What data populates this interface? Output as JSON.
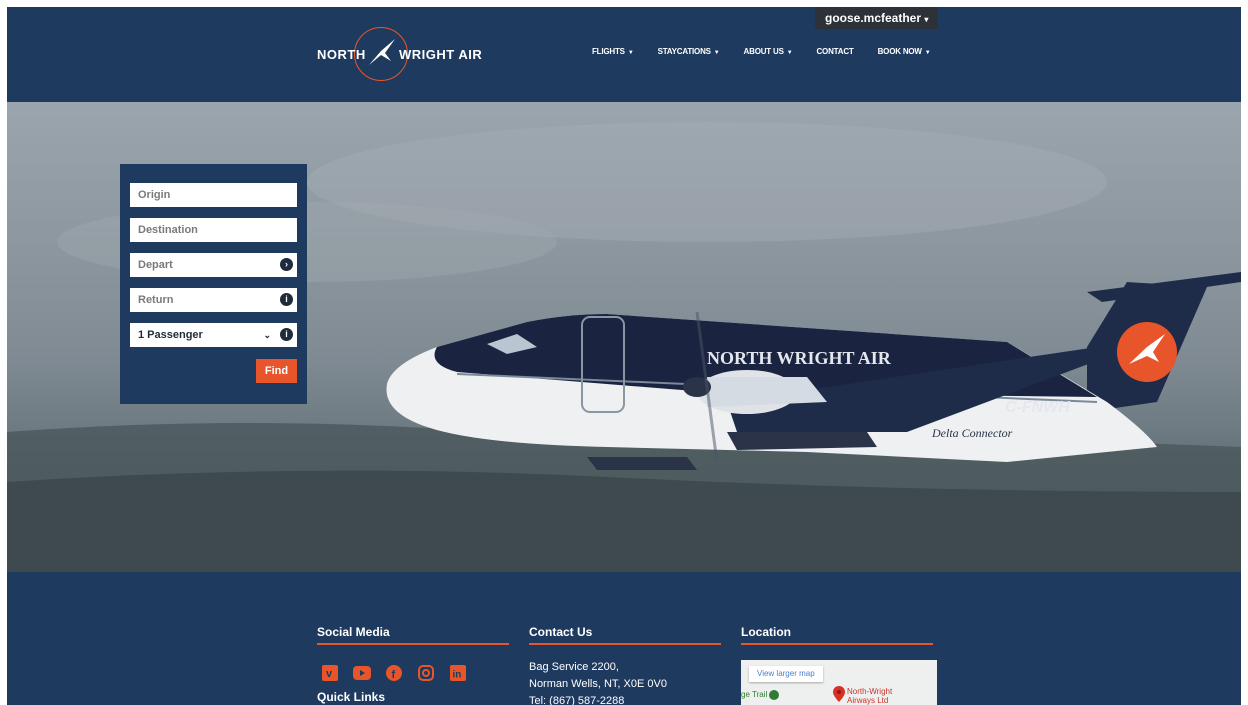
{
  "header": {
    "user": "goose.mcfeather",
    "logo_left": "NORTH",
    "logo_right": "WRIGHT AIR",
    "nav": [
      {
        "label": "FLIGHTS",
        "caret": true
      },
      {
        "label": "STAYCATIONS",
        "caret": true
      },
      {
        "label": "ABOUT US",
        "caret": true
      },
      {
        "label": "CONTACT",
        "caret": false
      },
      {
        "label": "BOOK NOW",
        "caret": true
      }
    ]
  },
  "hero": {
    "plane_livery": "NORTH WRIGHT AIR",
    "registration": "C-FNWH",
    "tagline": "Delta Connector"
  },
  "booking": {
    "origin_placeholder": "Origin",
    "destination_placeholder": "Destination",
    "depart_placeholder": "Depart",
    "return_placeholder": "Return",
    "passengers": "1 Passenger",
    "find_label": "Find"
  },
  "footer": {
    "social_title": "Social Media",
    "quick_links_title": "Quick Links",
    "contact_title": "Contact Us",
    "location_title": "Location",
    "contact_lines": [
      "Bag Service 2200,",
      "Norman Wells, NT, X0E 0V0",
      "Tel: (867) 587-2288"
    ],
    "map_link": "View larger map",
    "map_trail": "ge Trail",
    "map_label_1": "North-Wright",
    "map_label_2": "Airways Ltd",
    "social_icons": [
      "vimeo-icon",
      "youtube-icon",
      "facebook-icon",
      "instagram-icon",
      "linkedin-icon"
    ]
  },
  "colors": {
    "navy": "#1f3a5f",
    "accent": "#e8552a"
  }
}
